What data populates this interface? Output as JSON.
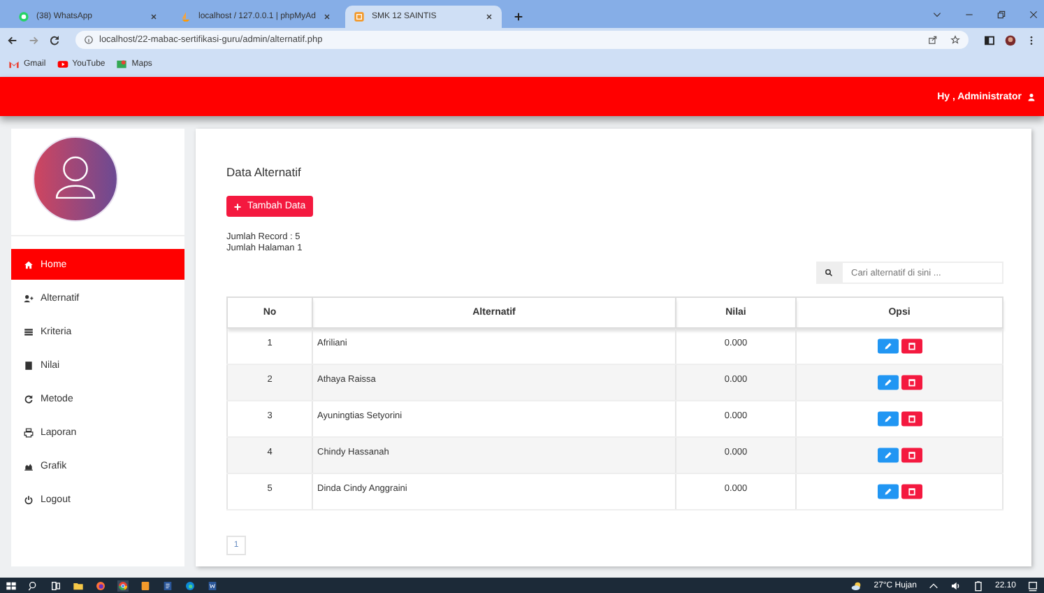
{
  "browser": {
    "tabs": [
      {
        "title": "(38) WhatsApp",
        "selected": false
      },
      {
        "title": "localhost / 127.0.0.1 | phpMyAd",
        "selected": false
      },
      {
        "title": "SMK 12 SAINTIS",
        "selected": true
      }
    ],
    "url": "localhost/22-mabac-sertifikasi-guru/admin/alternatif.php",
    "bookmarks": [
      {
        "label": "Gmail"
      },
      {
        "label": "YouTube"
      },
      {
        "label": "Maps"
      }
    ]
  },
  "header": {
    "greeting": "Hy , Administrator"
  },
  "sidebar": {
    "items": [
      {
        "label": "Home",
        "selected": true
      },
      {
        "label": "Alternatif",
        "selected": false
      },
      {
        "label": "Kriteria",
        "selected": false
      },
      {
        "label": "Nilai",
        "selected": false
      },
      {
        "label": "Metode",
        "selected": false
      },
      {
        "label": "Laporan",
        "selected": false
      },
      {
        "label": "Grafik",
        "selected": false
      },
      {
        "label": "Logout",
        "selected": false
      }
    ]
  },
  "main": {
    "title": "Data Alternatif",
    "add_button": "Tambah Data",
    "record_count": "Jumlah Record : 5",
    "page_count": "Jumlah Halaman 1",
    "search": {
      "placeholder": "Cari alternatif di sini ..."
    },
    "table": {
      "columns": [
        "No",
        "Alternatif",
        "Nilai",
        "Opsi"
      ],
      "rows": [
        {
          "no": "1",
          "name": "Afriliani",
          "value": "0.000"
        },
        {
          "no": "2",
          "name": "Athaya Raissa",
          "value": "0.000"
        },
        {
          "no": "3",
          "name": "Ayuningtias Setyorini",
          "value": "0.000"
        },
        {
          "no": "4",
          "name": "Chindy Hassanah",
          "value": "0.000"
        },
        {
          "no": "5",
          "name": "Dinda Cindy Anggraini",
          "value": "0.000"
        }
      ]
    },
    "pagination": [
      {
        "label": "1",
        "selected": false
      }
    ]
  },
  "taskbar": {
    "weather": "27°C Hujan",
    "time": "22.10"
  }
}
